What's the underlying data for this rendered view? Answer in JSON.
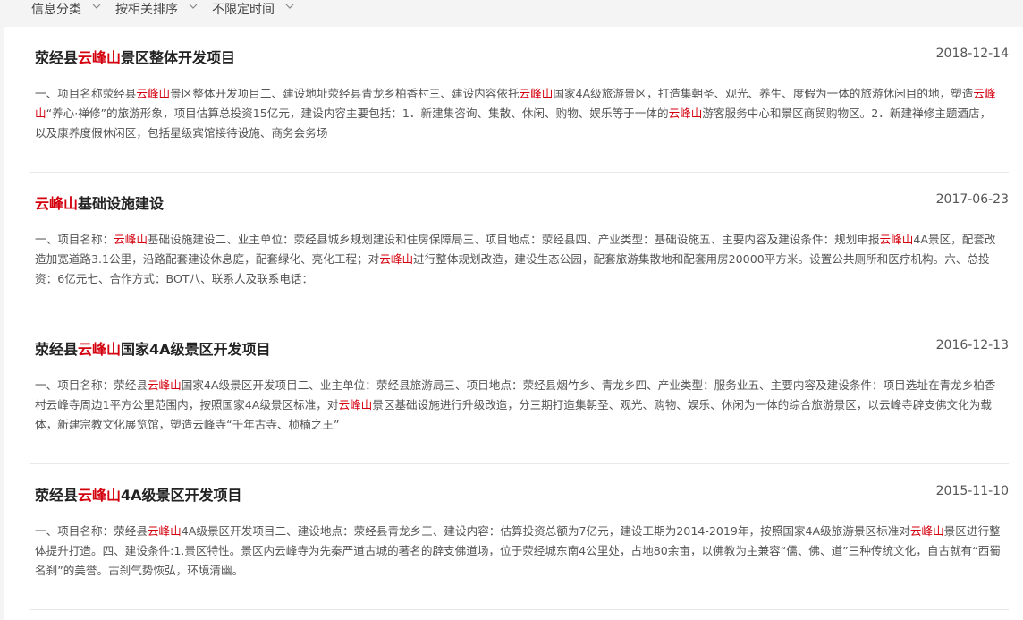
{
  "filters": [
    {
      "label": "信息分类"
    },
    {
      "label": "按相关排序"
    },
    {
      "label": "不限定时间"
    }
  ],
  "highlight_color": "#d4000e",
  "items": [
    {
      "title": [
        {
          "text": "荥经县",
          "hl": false
        },
        {
          "text": "云峰山",
          "hl": true
        },
        {
          "text": "景区整体开发项目",
          "hl": false
        }
      ],
      "date": "2018-12-14",
      "desc": [
        {
          "text": "一、项目名称荥经县",
          "hl": false
        },
        {
          "text": "云峰山",
          "hl": true
        },
        {
          "text": "景区整体开发项目二、建设地址荥经县青龙乡柏香村三、建设内容依托",
          "hl": false
        },
        {
          "text": "云峰山",
          "hl": true
        },
        {
          "text": "国家4A级旅游景区，打造集朝圣、观光、养生、度假为一体的旅游休闲目的地，塑造",
          "hl": false
        },
        {
          "text": "云峰山",
          "hl": true
        },
        {
          "text": "“养心·禅修”的旅游形象，项目估算总投资15亿元，建设内容主要包括：1．新建集咨询、集散、休闲、购物、娱乐等于一体的",
          "hl": false
        },
        {
          "text": "云峰山",
          "hl": true
        },
        {
          "text": "游客服务中心和景区商贸购物区。2．新建禅修主题酒店，以及康养度假休闲区，包括星级宾馆接待设施、商务会务场",
          "hl": false
        }
      ]
    },
    {
      "title": [
        {
          "text": "云峰山",
          "hl": true
        },
        {
          "text": "基础设施建设",
          "hl": false
        }
      ],
      "date": "2017-06-23",
      "desc": [
        {
          "text": "一、项目名称：",
          "hl": false
        },
        {
          "text": "云峰山",
          "hl": true
        },
        {
          "text": "基础设施建设二、业主单位：荥经县城乡规划建设和住房保障局三、项目地点：荥经县四、产业类型：基础设施五、主要内容及建设条件：规划申报",
          "hl": false
        },
        {
          "text": "云峰山",
          "hl": true
        },
        {
          "text": "4A景区，配套改造加宽道路3.1公里，沿路配套建设休息庭，配套绿化、亮化工程；对",
          "hl": false
        },
        {
          "text": "云峰山",
          "hl": true
        },
        {
          "text": "进行整体规划改造，建设生态公园，配套旅游集散地和配套用房20000平方米。设置公共厕所和医疗机构。六、总投资：6亿元七、合作方式：BOT八、联系人及联系电话：",
          "hl": false
        }
      ]
    },
    {
      "title": [
        {
          "text": "荥经县",
          "hl": false
        },
        {
          "text": "云峰山",
          "hl": true
        },
        {
          "text": "国家4A级景区开发项目",
          "hl": false
        }
      ],
      "date": "2016-12-13",
      "desc": [
        {
          "text": "一、项目名称：荥经县",
          "hl": false
        },
        {
          "text": "云峰山",
          "hl": true
        },
        {
          "text": "国家4A级景区开发项目二、业主单位：荥经县旅游局三、项目地点：荥经县烟竹乡、青龙乡四、产业类型：服务业五、主要内容及建设条件：项目选址在青龙乡柏香村云峰寺周边1平方公里范围内，按照国家4A级景区标准，对",
          "hl": false
        },
        {
          "text": "云峰山",
          "hl": true
        },
        {
          "text": "景区基础设施进行升级改造，分三期打造集朝圣、观光、购物、娱乐、休闲为一体的综合旅游景区，以云峰寺辟支佛文化为载体，新建宗教文化展览馆，塑造云峰寺“千年古寺、桢楠之王”",
          "hl": false
        }
      ]
    },
    {
      "title": [
        {
          "text": "荥经县",
          "hl": false
        },
        {
          "text": "云峰山",
          "hl": true
        },
        {
          "text": "4A级景区开发项目",
          "hl": false
        }
      ],
      "date": "2015-11-10",
      "desc": [
        {
          "text": "一、项目名称：荥经县",
          "hl": false
        },
        {
          "text": "云峰山",
          "hl": true
        },
        {
          "text": "4A级景区开发项目二、建设地点：荥经县青龙乡三、建设内容：估算投资总额为7亿元，建设工期为2014-2019年，按照国家4A级旅游景区标准对",
          "hl": false
        },
        {
          "text": "云峰山",
          "hl": true
        },
        {
          "text": "景区进行整体提升打造。四、建设条件:1.景区特性。景区内云峰寺为先秦严道古城的著名的辟支佛道场，位于荥经城东南4公里处，占地80余亩，以佛教为主兼容“儒、佛、道”三种传统文化，自古就有“西蜀名刹”的美誉。古刹气势恢弘，环境清幽。",
          "hl": false
        }
      ]
    }
  ]
}
